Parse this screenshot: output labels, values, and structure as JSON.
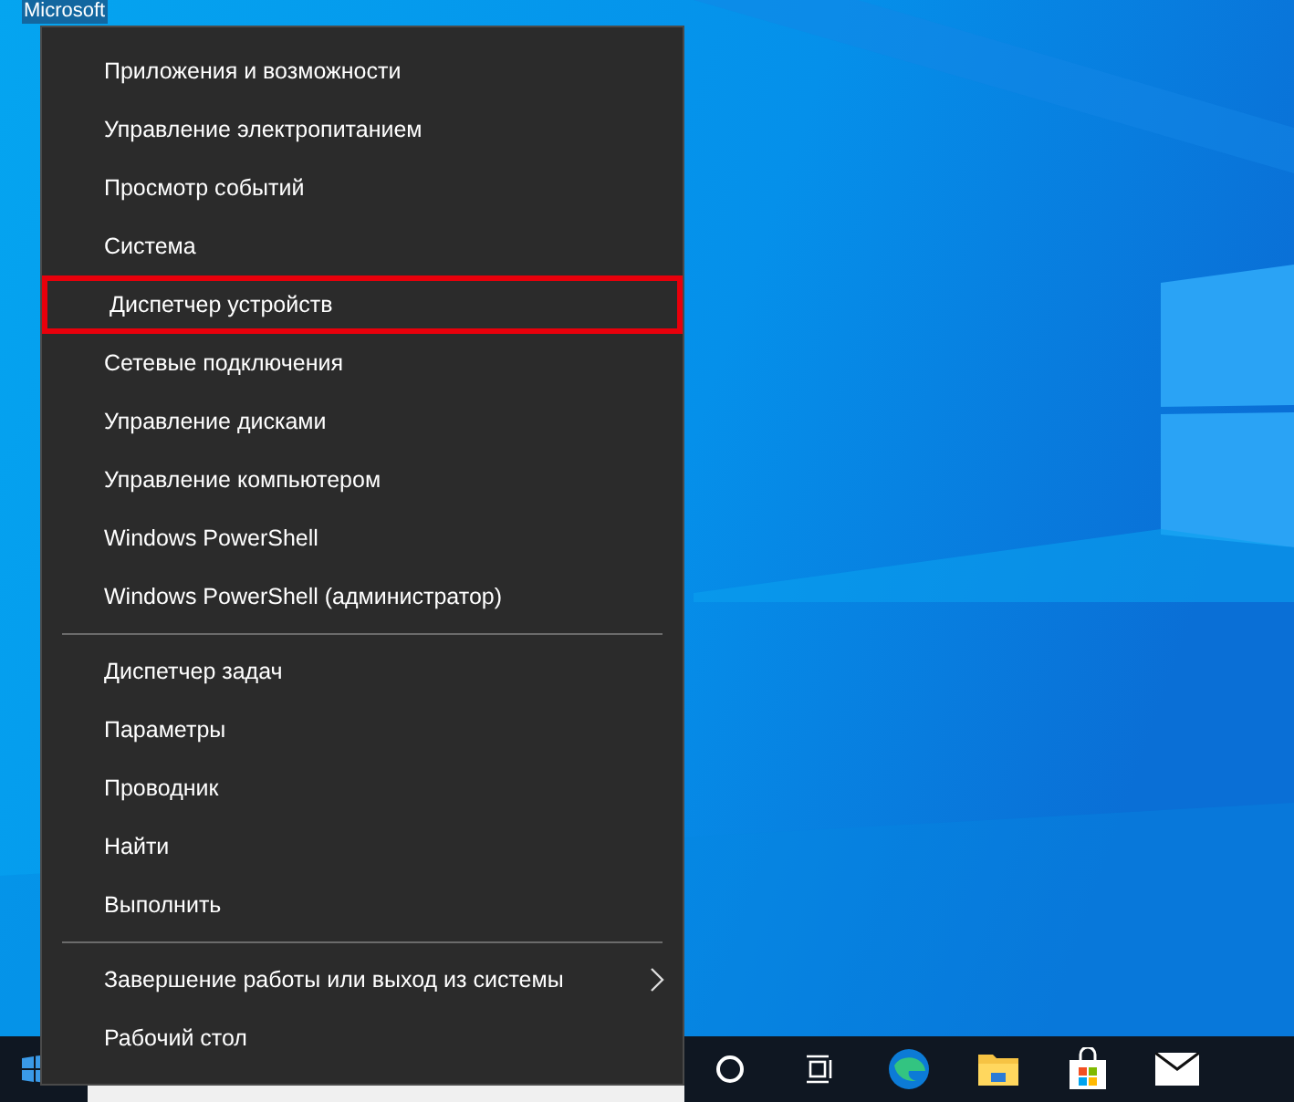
{
  "desktop_icon": {
    "label": "Microsoft"
  },
  "menu": {
    "groups": [
      {
        "items": [
          {
            "label": "Приложения и возможности",
            "selected": false,
            "kind": "plain"
          },
          {
            "label": "Управление электропитанием",
            "selected": false,
            "kind": "plain"
          },
          {
            "label": "Просмотр событий",
            "selected": false,
            "kind": "plain"
          },
          {
            "label": "Система",
            "selected": false,
            "kind": "plain"
          },
          {
            "label": "Диспетчер устройств",
            "selected": true,
            "kind": "plain"
          },
          {
            "label": "Сетевые подключения",
            "selected": false,
            "kind": "plain"
          },
          {
            "label": "Управление дисками",
            "selected": false,
            "kind": "plain"
          },
          {
            "label": "Управление компьютером",
            "selected": false,
            "kind": "plain"
          },
          {
            "label": "Windows PowerShell",
            "selected": false,
            "kind": "plain"
          },
          {
            "label": "Windows PowerShell (администратор)",
            "selected": false,
            "kind": "plain"
          }
        ]
      },
      {
        "items": [
          {
            "label": "Диспетчер задач",
            "selected": false,
            "kind": "plain"
          },
          {
            "label": "Параметры",
            "selected": false,
            "kind": "plain"
          },
          {
            "label": "Проводник",
            "selected": false,
            "kind": "plain"
          },
          {
            "label": "Найти",
            "selected": false,
            "kind": "plain"
          },
          {
            "label": "Выполнить",
            "selected": false,
            "kind": "plain"
          }
        ]
      },
      {
        "items": [
          {
            "label": "Завершение работы или выход из системы",
            "selected": false,
            "kind": "submenu"
          },
          {
            "label": "Рабочий стол",
            "selected": false,
            "kind": "plain"
          }
        ]
      }
    ]
  },
  "taskbar": {
    "icons": [
      {
        "kind": "cortana"
      },
      {
        "kind": "taskview"
      },
      {
        "kind": "edge"
      },
      {
        "kind": "explorer"
      },
      {
        "kind": "store"
      },
      {
        "kind": "mail"
      }
    ]
  }
}
